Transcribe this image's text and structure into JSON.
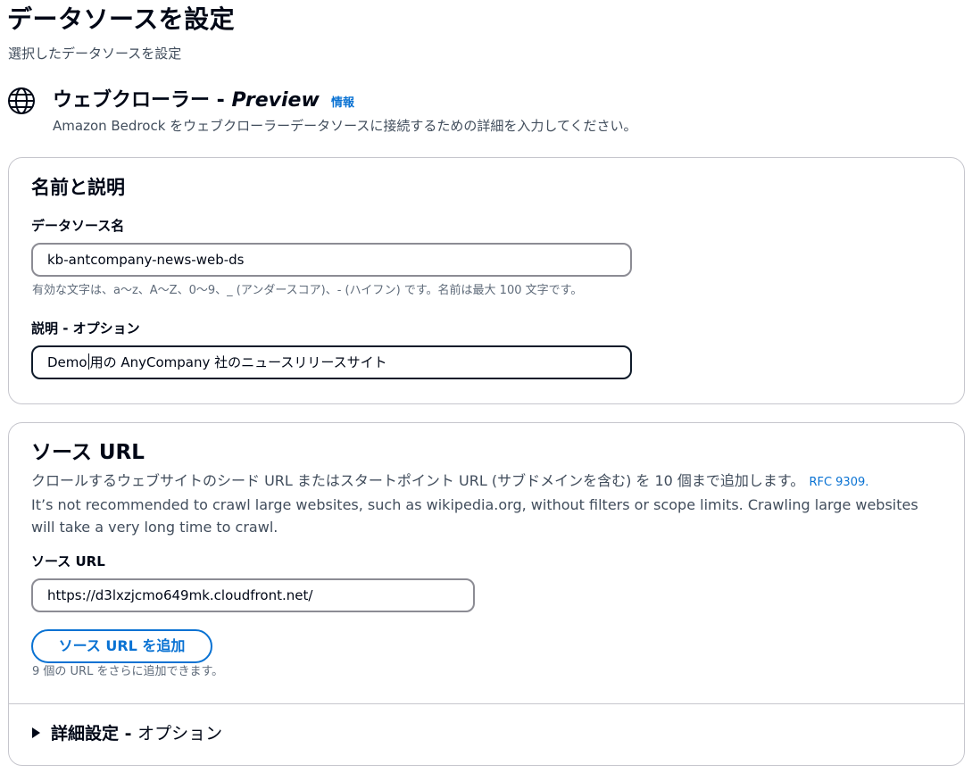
{
  "page": {
    "title": "データソースを設定",
    "subtitle": "選択したデータソースを設定"
  },
  "crawler": {
    "icon": "globe-icon",
    "title_main": "ウェブクローラー - ",
    "title_preview": "Preview",
    "info_link": "情報",
    "description": "Amazon Bedrock をウェブクローラーデータソースに接続するための詳細を入力してください。"
  },
  "name_section": {
    "heading": "名前と説明",
    "ds_name_label": "データソース名",
    "ds_name_value": "kb-antcompany-news-web-ds",
    "ds_name_hint": "有効な文字は、a～z、A～Z、0～9、_ (アンダースコア)、- (ハイフン) です。名前は最大 100 文字です。",
    "desc_label": "説明 - オプション",
    "desc_value_before_caret": "Demo",
    "desc_value_after_caret": "用の AnyCompany 社のニュースリリースサイト"
  },
  "source_url_section": {
    "heading": "ソース URL",
    "description": "クロールするウェブサイトのシード URL またはスタートポイント URL (サブドメインを含む) を 10 個まで追加します。",
    "rfc_link": "RFC 9309.",
    "warning": "It’s not recommended to crawl large websites, such as wikipedia.org, without filters or scope limits. Crawling large websites will take a very long time to crawl.",
    "url_label": "ソース URL",
    "url_value": "https://d3lxzjcmo649mk.cloudfront.net/",
    "add_button": "ソース URL を追加",
    "add_hint": "9 個の URL をさらに追加できます。",
    "advanced_bold": "詳細設定 - ",
    "advanced_rest": "オプション"
  },
  "colors": {
    "link": "#0972d3",
    "text": "#000716",
    "secondary_text": "#414d5c",
    "border": "#c6c6cd"
  }
}
